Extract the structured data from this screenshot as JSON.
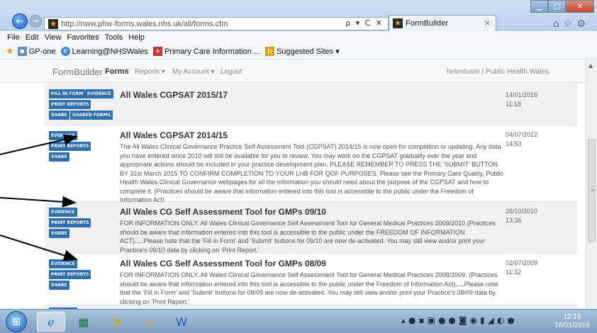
{
  "browser": {
    "url": "http://nww.phw-forms.wales.nhs.uk/all/forms.cfm",
    "address_tools": "ρ ▾ C ✕",
    "tab_title": "FormBuilder",
    "tab_close": "×",
    "menu": [
      "File",
      "Edit",
      "View",
      "Favorites",
      "Tools",
      "Help"
    ],
    "favorites": [
      {
        "label": "GP-one",
        "icon": "gp-one-icon"
      },
      {
        "label": "Learning@NHSWales",
        "icon": "ie-icon"
      },
      {
        "label": "Primary Care Information ...",
        "icon": "nhs-plus-icon"
      },
      {
        "label": "Suggested Sites ▾",
        "icon": "suggested-sites-icon"
      }
    ]
  },
  "app_nav": {
    "brand": "FormBuilder",
    "links": [
      "Forms",
      "Reports ▾",
      "My Account ▾",
      "Logout"
    ],
    "user": "helentuser | Public Health Wales"
  },
  "forms": [
    {
      "buttons": [
        "FILL IN FORM",
        "EVIDENCE",
        "PRINT REPORTS",
        "SHARE",
        "SHARED FORMS"
      ],
      "title": "All Wales CGPSAT 2015/17",
      "description": "",
      "date": "14/01/2016",
      "time": "11:18"
    },
    {
      "buttons": [
        "EVIDENCE",
        "PRINT REPORTS",
        "SHARE"
      ],
      "title": "All Wales CGPSAT 2014/15",
      "description": "The All Wales Clinical Governance Practice Self Assessment Tool (CGPSAT) 2014/15 is now open for completion or updating. Any data you have entered since 2010 will still be available for you to review. You may work on the CGPSAT gradually over the year and appropriate actions should be included in your practice development plan. PLEASE REMEMBER TO PRESS THE 'SUBMIT' BUTTON BY 31st March 2015 TO CONFIRM COMPLETION TO YOUR LHB FOR QOF PURPOSES. Please see the Primary Care Quality, Public Health Wales Clinical Governance webpages for all the information you should need about the purpose of the CGPSAT and how to complete it. (Practices should be aware that information entered into this tool is accessible to the public under the Freedom of Information Act)",
      "date": "04/07/2012",
      "time": "14:53"
    },
    {
      "buttons": [
        "EVIDENCE",
        "PRINT REPORTS",
        "SHARE"
      ],
      "title": "All Wales CG Self Assessment Tool for GMPs 09/10",
      "description": "FOR INFORMATION ONLY. All Wales Clinical Governance Self Assessment Tool for General Medical Practices 2009/2010 (Practices should be aware that information entered into this tool is accessible to the public under the FREEDOM OF INFORMATION ACT).....Please note that the 'Fill in Form' and 'Submit' buttons for 09/10 are now de-activated. You may still view and/or print your Practice's 09/10 data by clicking on 'Print Report.'",
      "date": "26/10/2010",
      "time": "13:36"
    },
    {
      "buttons": [
        "EVIDENCE",
        "PRINT REPORTS",
        "SHARE"
      ],
      "title": "All Wales CG Self Assessment Tool for GMPs 08/09",
      "description": "FOR INFORMATION ONLY. All Wales Clinical Governance Self Assessment Tool for General Medical Practices 2008/2009. (Practices should be aware that information entered into this tool is accessible to the public under the Freedom of Information Act).....Please note that the 'Fill in Form' and 'Submit' buttons for 08/09 are now de-activated. You may still view and/or print your Practice's 08/09 data by clicking on 'Print Report.'",
      "date": "02/07/2009",
      "time": "11:32"
    }
  ],
  "taskbar": {
    "apps": [
      "start-orb",
      "internet-explorer",
      "excel",
      "outlook",
      "file-explorer",
      "word"
    ],
    "clock_time": "12:19",
    "clock_date": "18/01/2016"
  },
  "colors": {
    "button_blue": "#2e6fb0",
    "arrow": "#000000"
  }
}
